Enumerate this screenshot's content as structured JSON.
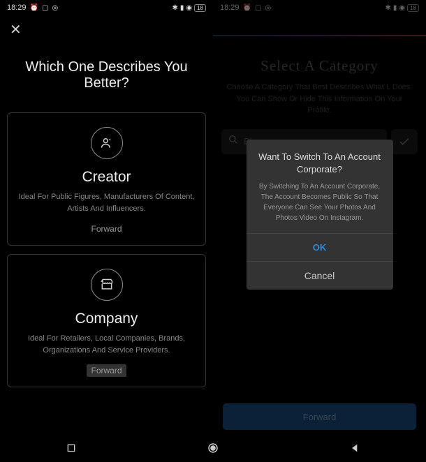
{
  "status": {
    "time": "18:29",
    "icons_left": [
      "alarm",
      "calendar",
      "instagram"
    ],
    "icons_right": [
      "bluetooth",
      "signal",
      "wifi",
      "battery"
    ],
    "battery_text": "18"
  },
  "screen1": {
    "title": "Which One Describes You Better?",
    "cards": [
      {
        "icon": "person-star",
        "title": "Creator",
        "desc": "Ideal For Public Figures, Manufacturers Of Content, Artists And Influencers.",
        "action": "Forward"
      },
      {
        "icon": "storefront",
        "title": "Company",
        "desc": "Ideal For Retailers, Local Companies, Brands, Organizations And Service Providers.",
        "action": "Forward"
      }
    ]
  },
  "screen2": {
    "title": "Select A Category",
    "subtitle": "Choose A Category That Best Describes What L Does. You Can Show Or Hide This Information On Your Profile.",
    "search_placeholder": "Bl",
    "forward": "Forward",
    "modal": {
      "title": "Want To Switch To An Account Corporate?",
      "body": "By Switching To An Account Corporate, The Account Becomes Public So That Everyone Can See Your Photos And Photos Video On Instagram.",
      "ok": "OK",
      "cancel": "Cancel"
    }
  }
}
